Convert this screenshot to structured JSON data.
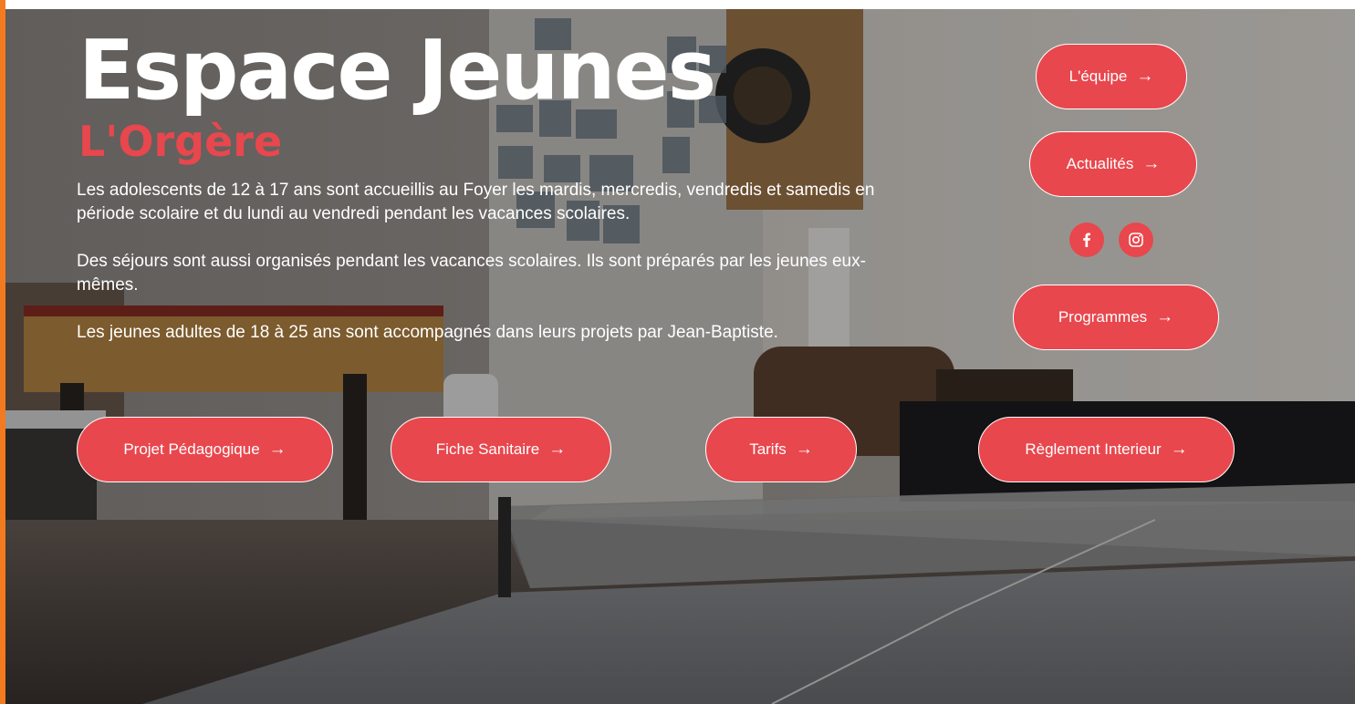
{
  "hero": {
    "title": "Espace Jeunes",
    "subtitle": "L'Orgère",
    "paragraphs": [
      "Les adolescents de 12 à 17 ans sont accueillis au Foyer les mardis, mercredis, vendredis et samedis en période scolaire et du lundi au vendredi pendant les vacances scolaires.",
      "Des séjours sont aussi organisés pendant les vacances scolaires. Ils sont préparés par les jeunes eux-mêmes.",
      "Les jeunes adultes de 18 à 25 ans sont accompagnés dans leurs projets par Jean-Baptiste."
    ]
  },
  "side_nav": {
    "equipe": "L'équipe",
    "actualites": "Actualités",
    "programmes": "Programmes",
    "arrow": "→"
  },
  "social": {
    "facebook_icon": "facebook-icon",
    "instagram_icon": "instagram-icon"
  },
  "bottom_nav": {
    "projet": "Projet Pédagogique",
    "fiche": "Fiche Sanitaire",
    "tarifs": "Tarifs",
    "reglement": "Règlement Interieur",
    "arrow": "→"
  },
  "colors": {
    "accent": "#e8474d",
    "border": "#f47a20"
  }
}
